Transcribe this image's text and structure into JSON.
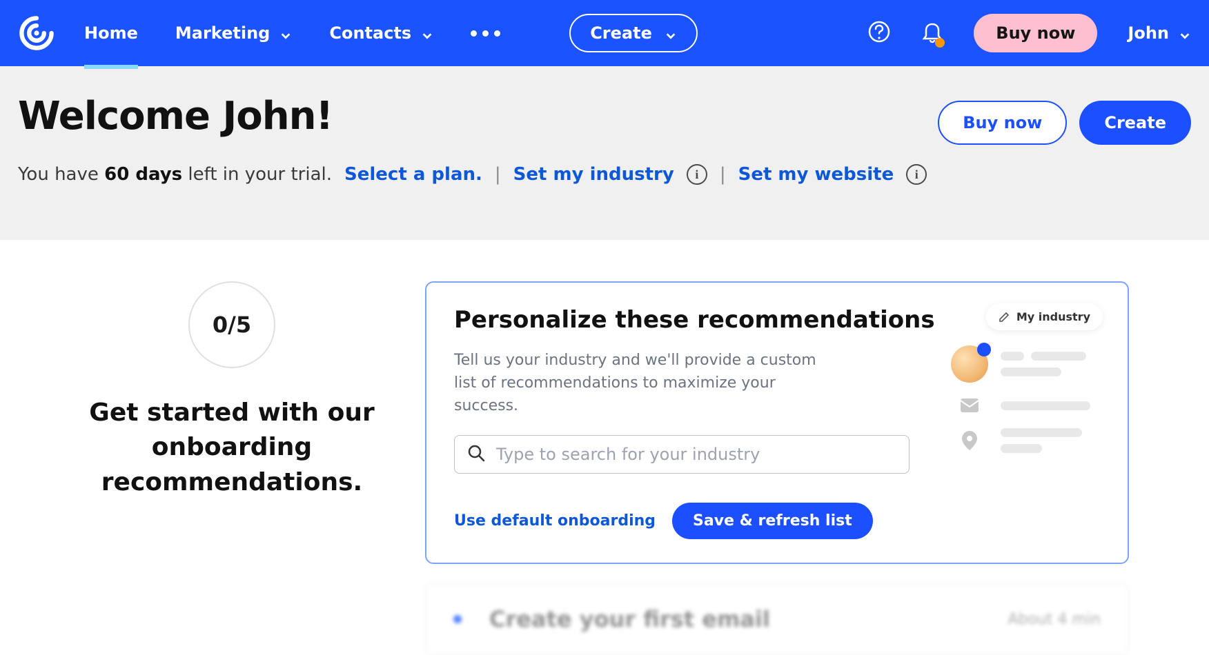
{
  "nav": {
    "items": [
      "Home",
      "Marketing",
      "Contacts"
    ],
    "create": "Create",
    "buy_now": "Buy now",
    "user": "John"
  },
  "hero": {
    "title": "Welcome John!",
    "trial_prefix": "You have ",
    "trial_days": "60 days",
    "trial_suffix": " left in your trial. ",
    "select_plan": "Select a plan",
    "set_industry": "Set my industry",
    "set_website": "Set my website",
    "buy_now": "Buy now",
    "create": "Create"
  },
  "onboarding": {
    "progress": "0/5",
    "heading": "Get started with our onboarding recommendations."
  },
  "personalize": {
    "title": "Personalize these recommendations",
    "desc": "Tell us your industry and we'll provide a custom list of recommendations to maximize your success.",
    "search_placeholder": "Type to search for your industry",
    "use_default": "Use default onboarding",
    "save": "Save & refresh list",
    "my_industry": "My industry"
  },
  "next_step": {
    "title": "Create your first email",
    "time": "About 4 min"
  }
}
